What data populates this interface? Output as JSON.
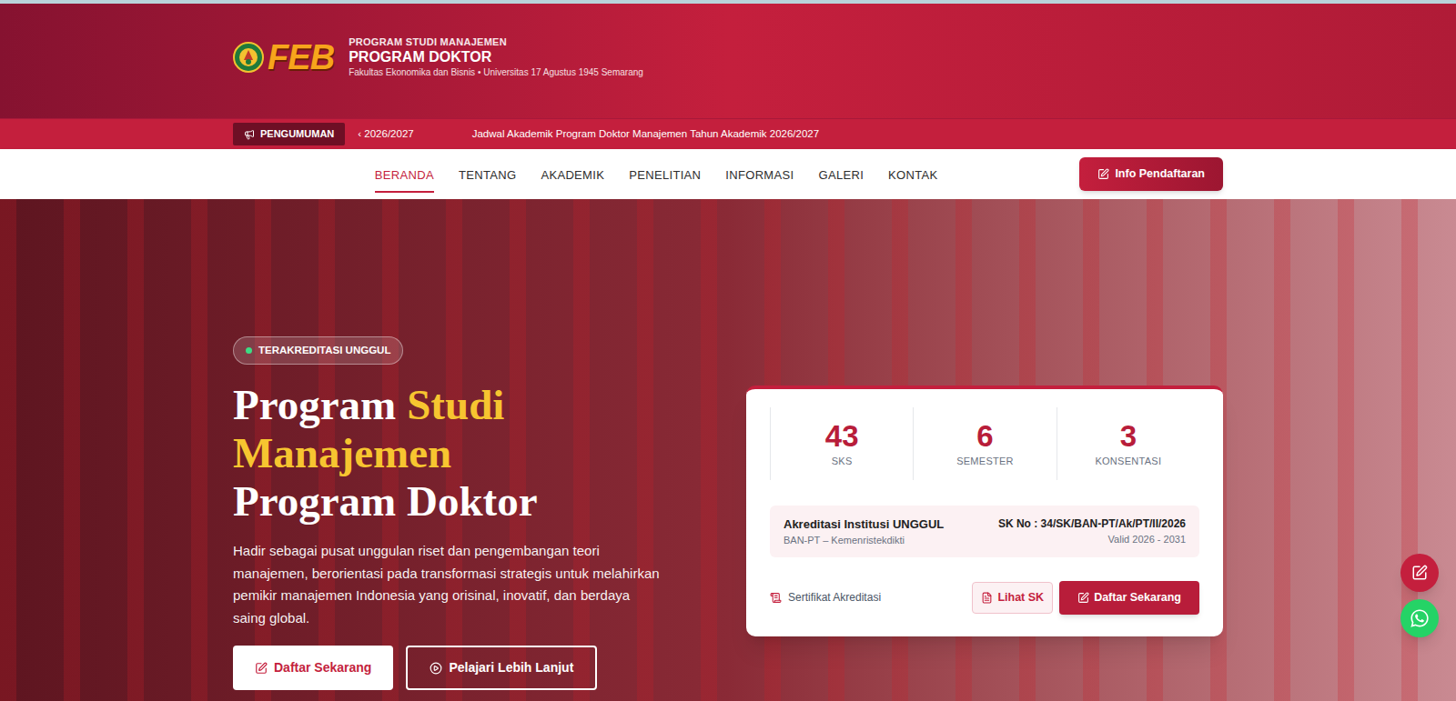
{
  "header": {
    "logo_text": "FEB",
    "overline": "PROGRAM STUDI MANAJEMEN",
    "title": "PROGRAM DOKTOR",
    "subtitle": "Fakultas Ekonomika dan Bisnis • Universitas 17 Agustus 1945 Semarang"
  },
  "announcement": {
    "badge": "PENGUMUMAN",
    "items": [
      "‹ 2026/2027",
      "Jadwal Akademik Program Doktor Manajemen Tahun Akademik 2026/2027"
    ]
  },
  "nav": {
    "items": [
      {
        "label": "BERANDA",
        "selected": true
      },
      {
        "label": "TENTANG",
        "selected": false
      },
      {
        "label": "AKADEMIK",
        "selected": false
      },
      {
        "label": "PENELITIAN",
        "selected": false
      },
      {
        "label": "INFORMASI",
        "selected": false
      },
      {
        "label": "GALERI",
        "selected": false
      },
      {
        "label": "KONTAK",
        "selected": false
      }
    ],
    "cta": "Info Pendaftaran"
  },
  "hero": {
    "badge": "TERAKREDITASI UNGGUL",
    "heading_lines": [
      [
        {
          "text": "Program",
          "highlight": false
        },
        {
          "text": "Studi",
          "highlight": true
        }
      ],
      [
        {
          "text": "Manajemen",
          "highlight": true
        }
      ],
      [
        {
          "text": "Program Doktor",
          "highlight": false
        }
      ]
    ],
    "description": "Hadir sebagai pusat unggulan riset dan pengembangan teori manajemen, berorientasi pada transformasi strategis untuk melahirkan pemikir manajemen Indonesia yang orisinal, inovatif, dan berdaya saing global.",
    "buttons": [
      {
        "label": "Daftar Sekarang",
        "kind": "primary"
      },
      {
        "label": "Pelajari Lebih Lanjut",
        "kind": "outline"
      }
    ]
  },
  "card": {
    "stats": [
      {
        "value": "43",
        "label": "SKS"
      },
      {
        "value": "6",
        "label": "SEMESTER"
      },
      {
        "value": "3",
        "label": "KONSENTASI"
      }
    ],
    "accreditation": {
      "title": "Akreditasi Institusi UNGGUL",
      "issuer": "BAN-PT – Kemenristekdikti",
      "sk": "SK No : 34/SK/BAN-PT/Ak/PT/II/2026",
      "validity": "Valid 2026 - 2031"
    },
    "certificate_label": "Sertifikat Akreditasi",
    "buttons": [
      {
        "label": "Lihat SK",
        "kind": "outline"
      },
      {
        "label": "Daftar Sekarang",
        "kind": "primary"
      }
    ]
  }
}
